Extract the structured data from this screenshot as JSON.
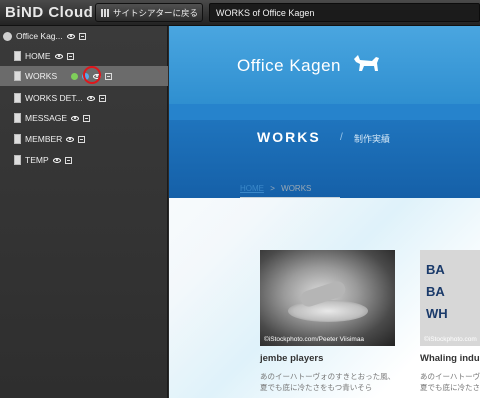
{
  "app": {
    "title": "BiND Cloud"
  },
  "toolbar": {
    "back_label": "サイトシアターに戻る",
    "page_title": "WORKS of Office Kagen"
  },
  "sidebar": {
    "root": {
      "label": "Office Kag..."
    },
    "items": [
      {
        "label": "HOME"
      },
      {
        "label": "WORKS",
        "selected": true
      },
      {
        "label": "WORKS DET..."
      },
      {
        "label": "MESSAGE"
      },
      {
        "label": "MEMBER"
      },
      {
        "label": "TEMP"
      }
    ]
  },
  "preview": {
    "logo_text": "Office Kagen",
    "section_title": "WORKS",
    "section_separator": "/",
    "section_subtitle": "制作実績",
    "breadcrumb": {
      "home": "HOME",
      "separator": ">",
      "current": "WORKS"
    },
    "cards": [
      {
        "photo_credit": "©iStockphoto.com/Peeter Viisimaa",
        "title": "jembe players",
        "text_lines": [
          "あのイーハトーヴォのすきとおった風、",
          "夏でも底に冷たさをもつ青いそら"
        ]
      },
      {
        "photo_credit": "©iStockphoto.com",
        "photo_text": [
          "BA",
          "BA",
          "WH"
        ],
        "title": "Whaling indu",
        "text_lines": [
          "あのイーハトーヴ",
          "夏でも底に冷たさ"
        ]
      }
    ]
  },
  "colors": {
    "highlight": "#e0161b",
    "header_blue": "#3a9bdc",
    "works_blue": "#1a6bb5"
  }
}
